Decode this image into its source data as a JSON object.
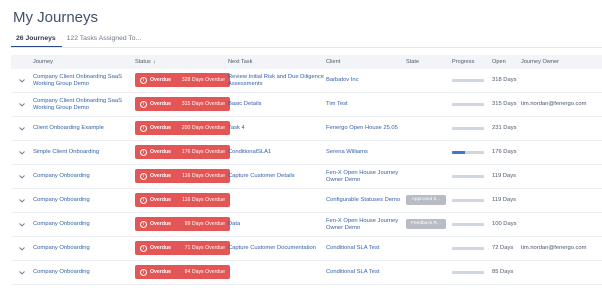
{
  "page_title": "My Journeys",
  "tabs": [
    {
      "label": "26 Journeys",
      "active": true
    },
    {
      "label": "122 Tasks Assigned To...",
      "active": false
    }
  ],
  "columns": {
    "journey": "Journey",
    "status": "Status",
    "next_task": "Next Task",
    "client": "Client",
    "state": "State",
    "progress": "Progress",
    "open": "Open",
    "owner": "Journey Owner"
  },
  "status_label": "Overdue",
  "colors": {
    "overdue": "#e45555",
    "progress_fill": "#3a78d8",
    "progress_track": "#cfd6e2",
    "link": "#2f5fa8"
  },
  "rows": [
    {
      "journey": [
        "Company Client Onboarding SaaS",
        "Working Group Demo"
      ],
      "days_overdue": "328 Days Overdue",
      "next_task": [
        "Review Initial Risk and Due Diligence",
        "Assessments"
      ],
      "client": [
        "Barbatov Inc"
      ],
      "state": "",
      "progress": 0,
      "open": "318 Days",
      "owner": ""
    },
    {
      "journey": [
        "Company Client Onboarding SaaS",
        "Working Group Demo"
      ],
      "days_overdue": "315 Days Overdue",
      "next_task": [
        "Basic Details"
      ],
      "client": [
        "Tim Test"
      ],
      "state": "",
      "progress": 0,
      "open": "315 Days",
      "owner": "tim.riordan@fenergo.com"
    },
    {
      "journey": [
        "Client Onboarding Example"
      ],
      "days_overdue": "200 Days Overdue",
      "next_task": [
        "Task 4"
      ],
      "client": [
        "Fenergo Open House 25.05"
      ],
      "state": "",
      "progress": 0,
      "open": "231 Days",
      "owner": ""
    },
    {
      "journey": [
        "Simple Client Onboarding"
      ],
      "days_overdue": "176 Days Overdue",
      "next_task": [
        "ConditionalSLA1"
      ],
      "client": [
        "Serena Williams"
      ],
      "state": "",
      "progress": 0.4,
      "open": "176 Days",
      "owner": ""
    },
    {
      "journey": [
        "Company Onboarding"
      ],
      "days_overdue": "116 Days Overdue",
      "next_task": [
        "Capture Customer Details"
      ],
      "client": [
        "Fen-X Open House Journey",
        "Owner Demo"
      ],
      "state": "",
      "progress": 0,
      "open": "119 Days",
      "owner": ""
    },
    {
      "journey": [
        "Company Onboarding"
      ],
      "days_overdue": "116 Days Overdue",
      "next_task": [
        ""
      ],
      "client": [
        "Configurable Statuses Demo"
      ],
      "state": "Approved b...",
      "progress": 0,
      "open": "119 Days",
      "owner": ""
    },
    {
      "journey": [
        "Company Onboarding"
      ],
      "days_overdue": "99 Days Overdue",
      "next_task": [
        "Data"
      ],
      "client": [
        "Fen-X Open House Journey",
        "Owner Demo"
      ],
      "state": "Feedback R...",
      "progress": 0,
      "open": "100 Days",
      "owner": ""
    },
    {
      "journey": [
        "Company Onboarding"
      ],
      "days_overdue": "71 Days Overdue",
      "next_task": [
        "Capture Customer Documentation"
      ],
      "client": [
        "Conditional SLA Test"
      ],
      "state": "",
      "progress": 0,
      "open": "72 Days",
      "owner": "tim.riordan@fenergo.com"
    },
    {
      "journey": [
        "Company Onboarding"
      ],
      "days_overdue": "84 Days Overdue",
      "next_task": [
        ""
      ],
      "client": [
        "Conditional SLA Test"
      ],
      "state": "",
      "progress": 0,
      "open": "85 Days",
      "owner": ""
    }
  ]
}
